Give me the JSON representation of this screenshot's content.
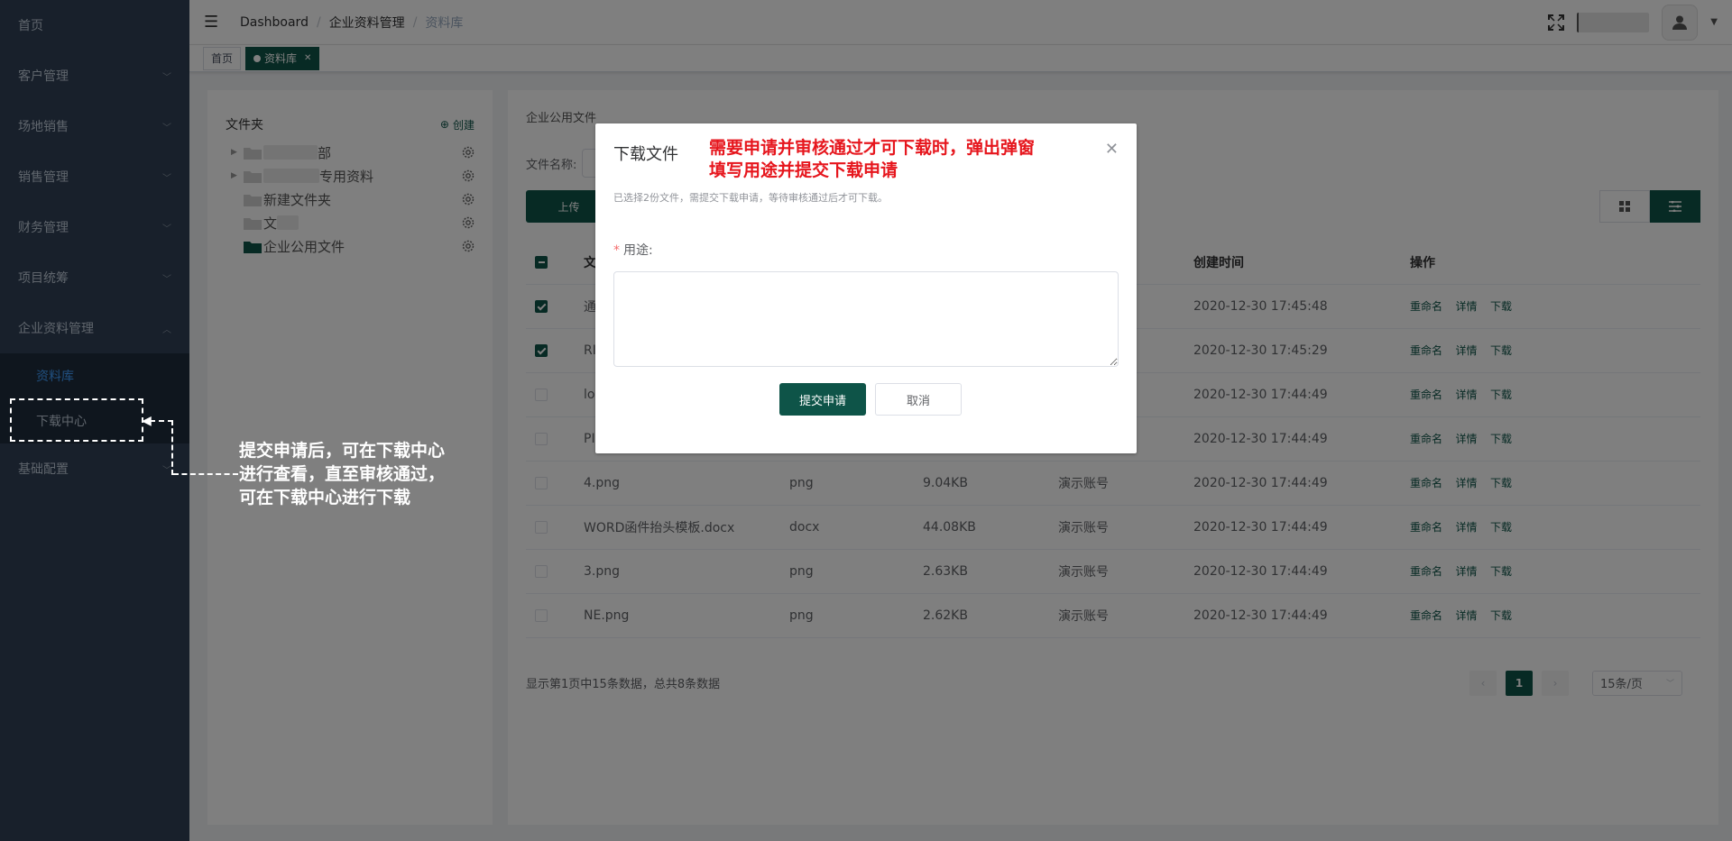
{
  "sidebar": {
    "items": [
      {
        "label": "首页"
      },
      {
        "label": "客户管理"
      },
      {
        "label": "场地销售"
      },
      {
        "label": "销售管理"
      },
      {
        "label": "财务管理"
      },
      {
        "label": "项目统筹"
      },
      {
        "label": "企业资料管理"
      }
    ],
    "submenu": [
      {
        "label": "资料库"
      },
      {
        "label": "下载中心"
      }
    ],
    "after": [
      {
        "label": "基础配置"
      }
    ]
  },
  "header": {
    "breadcrumb": [
      "Dashboard",
      "企业资料管理",
      "资料库"
    ]
  },
  "tags": [
    {
      "label": "首页"
    },
    {
      "label": "资料库"
    }
  ],
  "tree": {
    "title": "文件夹",
    "create_label": "创建",
    "nodes": [
      {
        "label": "部"
      },
      {
        "label": "专用资料"
      },
      {
        "label": "新建文件夹"
      },
      {
        "label": "文"
      },
      {
        "label": "企业公用文件"
      }
    ]
  },
  "main": {
    "section_title": "企业公用文件",
    "search_label": "文件名称:",
    "upload_label": "上传",
    "columns": {
      "name": "文",
      "created": "创建时间",
      "ops": "操作"
    },
    "rows": [
      {
        "name": "通",
        "type": "",
        "size": "",
        "owner": "",
        "created": "2020-12-30 17:45:48",
        "checked": true
      },
      {
        "name": "RI",
        "type": "",
        "size": "",
        "owner": "",
        "created": "2020-12-30 17:45:29",
        "checked": true
      },
      {
        "name": "lo",
        "type": "",
        "size": "",
        "owner": "",
        "created": "2020-12-30 17:44:49",
        "checked": false
      },
      {
        "name": "PI",
        "type": "",
        "size": "",
        "owner": "",
        "created": "2020-12-30 17:44:49",
        "checked": false
      },
      {
        "name": "4.png",
        "type": "png",
        "size": "9.04KB",
        "owner": "演示账号",
        "created": "2020-12-30 17:44:49",
        "checked": false
      },
      {
        "name": "WORD函件抬头模板.docx",
        "type": "docx",
        "size": "44.08KB",
        "owner": "演示账号",
        "created": "2020-12-30 17:44:49",
        "checked": false
      },
      {
        "name": "3.png",
        "type": "png",
        "size": "2.63KB",
        "owner": "演示账号",
        "created": "2020-12-30 17:44:49",
        "checked": false
      },
      {
        "name": "NE.png",
        "type": "png",
        "size": "2.62KB",
        "owner": "演示账号",
        "created": "2020-12-30 17:44:49",
        "checked": false
      }
    ],
    "ops": {
      "rename": "重命名",
      "detail": "详情",
      "download": "下载"
    },
    "summary": "显示第1页中15条数据，总共8条数据",
    "current_page": "1",
    "page_size": "15条/页"
  },
  "dialog": {
    "title": "下载文件",
    "hint": "已选择2份文件，需提交下载申请，等待审核通过后才可下载。",
    "field_label": "用途:",
    "submit_label": "提交申请",
    "cancel_label": "取消"
  },
  "annotations": {
    "red": [
      "需要申请并审核通过才可下载时，弹出弹窗",
      "填写用途并提交下载申请"
    ],
    "white": [
      "提交申请后，可在下载中心",
      "进行查看，直至审核通过，",
      "可在下载中心进行下载"
    ]
  },
  "colors": {
    "primary": "#0e5448",
    "sidebar": "#304156",
    "annotation_red": "#e6161d"
  }
}
